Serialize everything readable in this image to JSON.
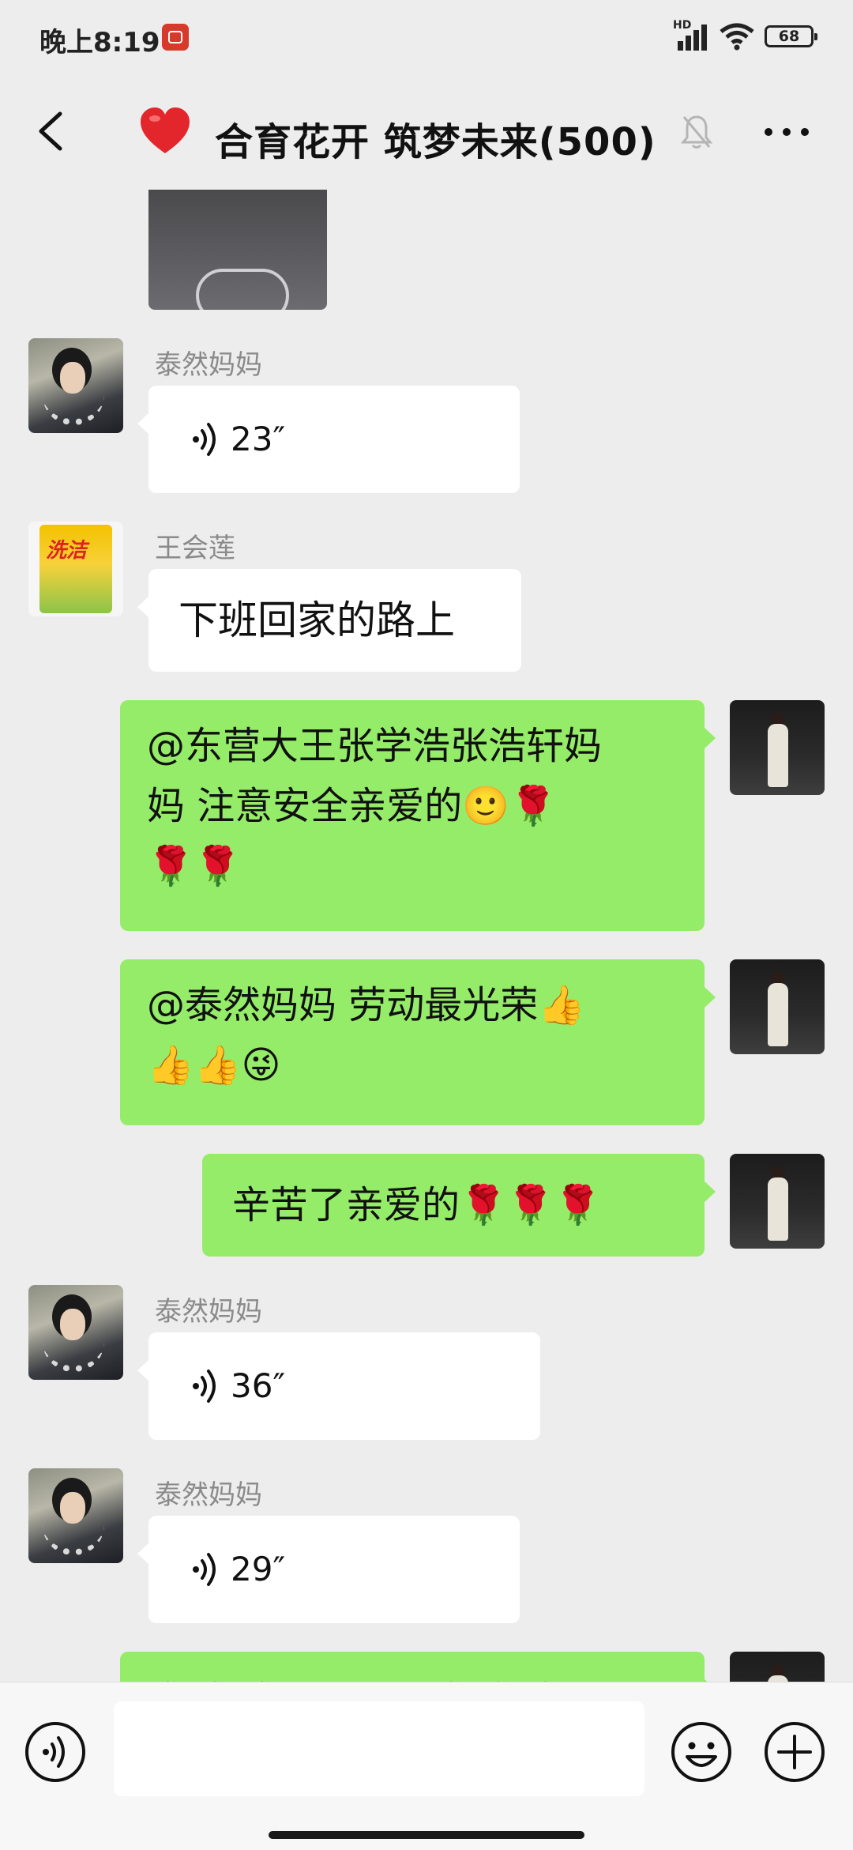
{
  "status_bar": {
    "time": "晚上8:19",
    "network_label": "HD",
    "battery": "68"
  },
  "header": {
    "emoji": "❤️",
    "title": "合育花开 筑梦未来(500)"
  },
  "messages": [
    {
      "type": "image"
    },
    {
      "type": "voice",
      "sender": "泰然妈妈",
      "duration": "23″"
    },
    {
      "type": "text",
      "sender": "王会莲",
      "text": "下班回家的路上"
    },
    {
      "type": "self_text",
      "line1": "@东营大王张学浩张浩轩妈",
      "line2": "妈  注意安全亲爱的🙂🌹",
      "line3": "🌹🌹"
    },
    {
      "type": "self_text",
      "line1": "@泰然妈妈  劳动最光荣👍",
      "line2": "👍👍😜"
    },
    {
      "type": "self_text",
      "line1": "辛苦了亲爱的🌹🌹🌹"
    },
    {
      "type": "voice",
      "sender": "泰然妈妈",
      "duration": "36″"
    },
    {
      "type": "voice",
      "sender": "泰然妈妈",
      "duration": "29″"
    },
    {
      "type": "self_text",
      "line1": "🌹🌹🌹👍👍👍🌹🌹🌹"
    }
  ],
  "avatars": {
    "bag_logo": "洗洁"
  }
}
